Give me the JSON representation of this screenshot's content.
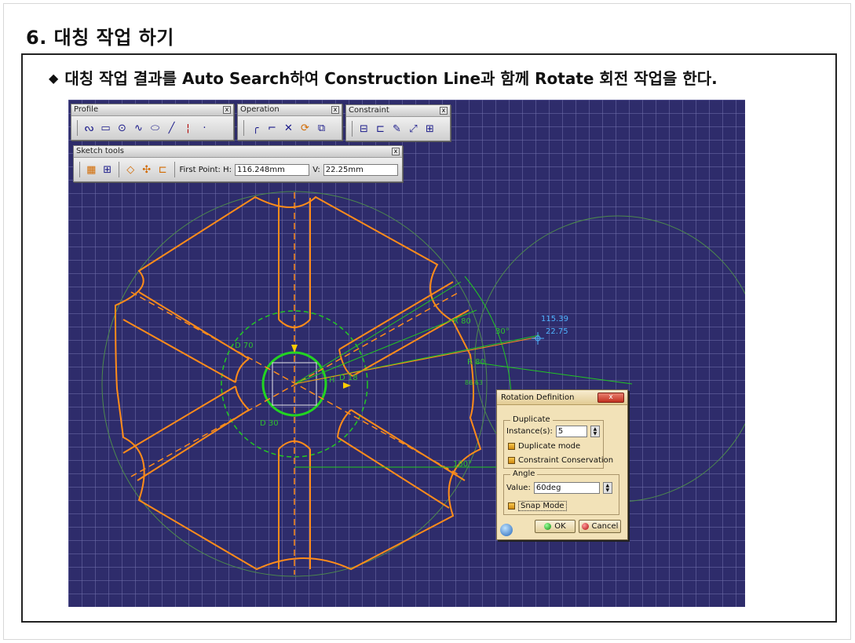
{
  "slide": {
    "title": "6. 대칭 작업 하기",
    "bullet": "대칭 작업 결과를 Auto Search하여 Construction Line과 함께 Rotate 회전 작업을 한다.",
    "bullet_symbol": "◆"
  },
  "toolbars": {
    "profile": {
      "title": "Profile",
      "close": "x"
    },
    "operation": {
      "title": "Operation",
      "close": "x"
    },
    "constraint": {
      "title": "Constraint",
      "close": "x"
    },
    "sketch_tools": {
      "title": "Sketch tools",
      "close": "x",
      "first_point_label": "First Point: H:",
      "h_value": "116.248mm",
      "v_label": "V:",
      "v_value": "22.25mm"
    }
  },
  "drawing": {
    "dims": {
      "d70": "D 70",
      "d30": "D 30",
      "d18": "D 18",
      "r80a": "R 80",
      "r80b": "R 80",
      "angle30": "30°",
      "angle180": "180°",
      "coord_x": "115.39",
      "coord_y": "22.75",
      "h_marker": "H",
      "small_label": "86.63"
    },
    "colors": {
      "background": "#2e2c6b",
      "profile": "#ff8c1a",
      "construction": "#22c722",
      "dimension": "#2fbf2f",
      "coordinate": "#4fb4ff"
    }
  },
  "dialog": {
    "title": "Rotation Definition",
    "close": "x",
    "duplicate_group": "Duplicate",
    "instances_label": "Instance(s):",
    "instances_value": "5",
    "duplicate_mode": "Duplicate mode",
    "constraint_conservation": "Constraint Conservation",
    "angle_group": "Angle",
    "value_label": "Value:",
    "angle_value": "60deg",
    "snap_mode": "Snap Mode",
    "ok": "OK",
    "cancel": "Cancel"
  }
}
